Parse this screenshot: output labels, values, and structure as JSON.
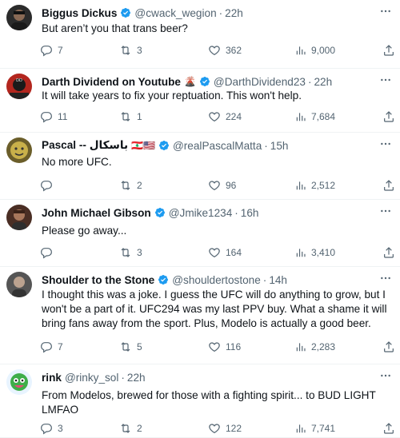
{
  "tweets": [
    {
      "name": "Biggus Dickus",
      "handle": "@cwack_wegion",
      "time": "22h",
      "text": "But aren’t you that trans beer?",
      "emoji": "",
      "avatar_color": "#3a3a3a",
      "replies": "7",
      "retweets": "3",
      "likes": "362",
      "views": "9,000"
    },
    {
      "name": "Darth Dividend on Youtube",
      "handle": "@DarthDividend23",
      "time": "22h",
      "text": "It will take years to fix your reptuation.  This won't help.",
      "emoji": "🌋",
      "avatar_color": "#b3261e",
      "replies": "11",
      "retweets": "1",
      "likes": "224",
      "views": "7,684"
    },
    {
      "name": "Pascal -- باسكال",
      "handle": "@realPascalMatta",
      "time": "15h",
      "text": "No more UFC.",
      "emoji": "🇱🇧🇺🇸",
      "avatar_color": "#7a6a2a",
      "replies": "",
      "retweets": "2",
      "likes": "96",
      "views": "2,512"
    },
    {
      "name": "John Michael Gibson",
      "handle": "@Jmike1234",
      "time": "16h",
      "text": "Please go away...",
      "emoji": "",
      "avatar_color": "#5b3a2e",
      "replies": "",
      "retweets": "3",
      "likes": "164",
      "views": "3,410"
    },
    {
      "name": "Shoulder to the Stone",
      "handle": "@shouldertostone",
      "time": "14h",
      "text": "I thought this was a joke. I guess the UFC will do anything to grow, but I won't be a part of it. UFC294 was my last PPV buy. What a shame it will bring fans away from the sport. Plus, Modelo is actually a good beer.",
      "emoji": "",
      "avatar_color": "#4a4a4a",
      "replies": "7",
      "retweets": "5",
      "likes": "116",
      "views": "2,283"
    },
    {
      "name": "rink",
      "handle": "@rinky_sol",
      "time": "22h",
      "text": "From Modelos, brewed for those with a fighting spirit... to BUD LIGHT LMFAO",
      "emoji": "",
      "avatar_color": "#3fae4a",
      "replies": "3",
      "retweets": "2",
      "likes": "122",
      "views": "7,741"
    }
  ],
  "colors": {
    "verified": "#1d9bf0",
    "muted": "#536471",
    "text": "#0f1419"
  },
  "icons": {
    "reply": "reply-icon",
    "retweet": "retweet-icon",
    "like": "heart-icon",
    "views": "views-icon",
    "share": "share-icon",
    "more": "more-icon",
    "verified": "verified-badge-icon"
  }
}
